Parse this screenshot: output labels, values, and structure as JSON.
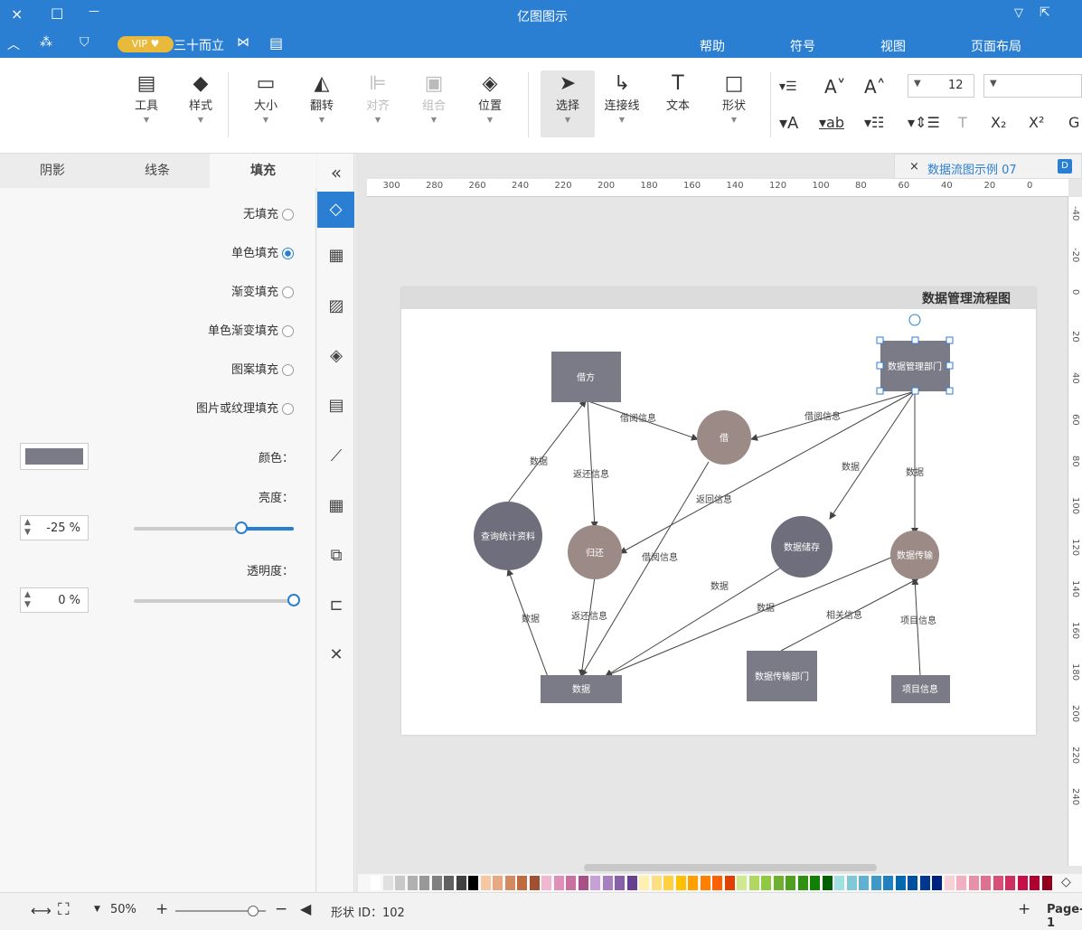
{
  "window": {
    "title": "亿图图示",
    "close": "×",
    "maximize": "□",
    "minimize": "—"
  },
  "quickbar": {
    "vip": "VIP",
    "user": "三十而立"
  },
  "menu": [
    "页面布局",
    "视图",
    "符号",
    "帮助"
  ],
  "ribbon": {
    "font_size": "12",
    "buttons": [
      {
        "id": "shape",
        "label": "形状",
        "icon": "□"
      },
      {
        "id": "text",
        "label": "文本",
        "icon": "T"
      },
      {
        "id": "connector",
        "label": "连接线",
        "icon": "↳"
      },
      {
        "id": "select",
        "label": "选择",
        "icon": "➤"
      },
      {
        "id": "position",
        "label": "位置",
        "icon": "◈"
      },
      {
        "id": "group",
        "label": "组合",
        "icon": "▣"
      },
      {
        "id": "align",
        "label": "对齐",
        "icon": "⊫"
      },
      {
        "id": "flip",
        "label": "翻转",
        "icon": "◭"
      },
      {
        "id": "size",
        "label": "大小",
        "icon": "▭"
      },
      {
        "id": "style",
        "label": "样式",
        "icon": "◆"
      },
      {
        "id": "tools",
        "label": "工具",
        "icon": "▤"
      }
    ]
  },
  "panel": {
    "tabs": [
      "填充",
      "线条",
      "阴影"
    ],
    "fill_options": [
      "无填充",
      "单色填充",
      "渐变填充",
      "单色渐变填充",
      "图案填充",
      "图片或纹理填充"
    ],
    "selected_fill": "单色填充",
    "color_label": "颜色：",
    "color_value": "#7b7b87",
    "brightness_label": "亮度：",
    "brightness_value": "-25 %",
    "brightness_level": 0.67,
    "opacity_label": "透明度：",
    "opacity_value": "0 %",
    "opacity_level": 0.0
  },
  "doc_tab": {
    "title": "数据流图示例 07",
    "close": "×"
  },
  "ruler_h": [
    "0",
    "20",
    "40",
    "60",
    "80",
    "100",
    "120",
    "140",
    "160",
    "180",
    "200",
    "220",
    "240",
    "260",
    "280",
    "300"
  ],
  "ruler_v": [
    "-40",
    "-20",
    "0",
    "20",
    "40",
    "60",
    "80",
    "100",
    "120",
    "140",
    "160",
    "180",
    "200",
    "220",
    "240"
  ],
  "diagram": {
    "title": "数据管理流程图",
    "nodes": {
      "dept": "数据管理部门",
      "borrow": "借方",
      "lend": "借",
      "query": "查询统计资料",
      "return": "归还",
      "storage": "数据储存",
      "transfer": "数据传输",
      "data": "数据",
      "transfer_dept": "数据传输部门",
      "project": "项目信息"
    },
    "edges": {
      "e1": "借阅信息",
      "e2": "借阅信息",
      "e3": "数据",
      "e4": "数据",
      "e5": "返还信息",
      "e6": "返回信息",
      "e7": "借阅信息",
      "e8": "数据",
      "e9": "返还信息",
      "e10": "数据",
      "e11": "数据",
      "e12": "相关信息",
      "e13": "项目信息",
      "e14": "数据"
    }
  },
  "status": {
    "page": "Page-1",
    "add": "+",
    "shape_id": "形状 ID：102",
    "zoom": "50%",
    "minus": "−",
    "plus": "+"
  },
  "colors": {
    "accent": "#2b7fd3",
    "rect": "#7b7b87",
    "circle_dark": "#6e6e7c",
    "circle_brown": "#9c8a86"
  }
}
